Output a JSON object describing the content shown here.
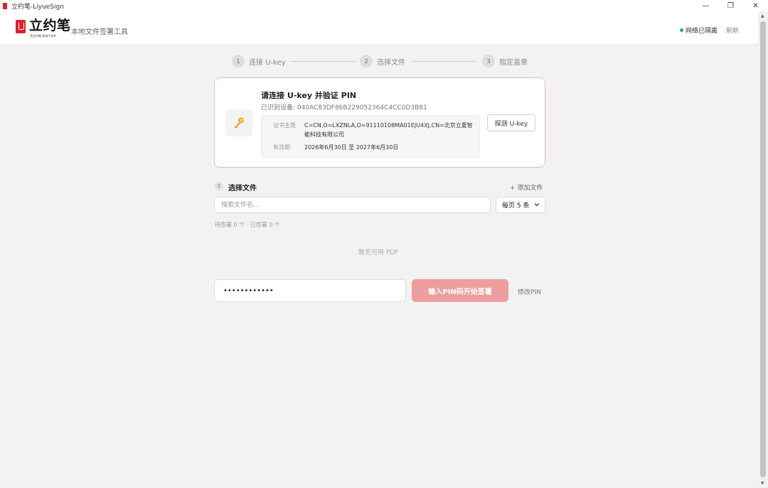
{
  "window": {
    "title": "立约笔-LiyueSign",
    "minimize_glyph": "—",
    "restore_glyph": "❐",
    "close_glyph": "✕"
  },
  "header": {
    "logo_text": "立约笔",
    "logo_tagline": "用立约笔·签电子合约",
    "subtitle": "本地文件签署工具",
    "network_status": "网络已隔离",
    "network_status_color": "#2bb24c",
    "refresh_label": "刷新"
  },
  "steps": [
    {
      "num": "1",
      "label": "连接 U-key"
    },
    {
      "num": "2",
      "label": "选择文件"
    },
    {
      "num": "3",
      "label": "指定盖章"
    }
  ],
  "ukey_card": {
    "icon": "key-icon",
    "title": "请连接 U-key 并验证 PIN",
    "device_label": "已识别设备:",
    "device_id": "040AC83DF86B229052364C4CC0D3B81",
    "cert": {
      "subject_label": "证书主题",
      "subject_value": "C=CN,O=LXZNLA,O=91110108MA01EJU4XJ,CN=北京立夏智能科技有限公司",
      "validity_label": "有效期",
      "validity_value": "2026年6月30日 至 2027年6月30日"
    },
    "probe_button": "探测 U-key",
    "border_color": "#f1b6b9"
  },
  "file_section": {
    "num": "2",
    "title": "选择文件",
    "add_file": "+ 添加文件",
    "search_placeholder": "搜索文件名...",
    "page_size_selected": "每页 5 条",
    "counts": "待签署 0 个 · 已签署 0 个",
    "empty_text": "暂无可用 PDF"
  },
  "pin": {
    "value": "••••••••••••",
    "sign_button": "输入PIN码开始签署",
    "sign_button_color": "#ee9d9f",
    "change_pin": "修改PIN"
  },
  "colors": {
    "brand": "#d9232e",
    "background": "#f2f2f2"
  }
}
